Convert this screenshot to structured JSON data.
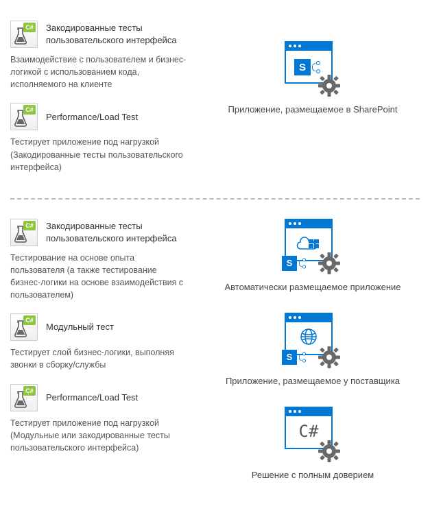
{
  "icons": {
    "test_badge": "C#"
  },
  "section1": {
    "tests": [
      {
        "title": "Закодированные тесты\nпользовательского интерфейса",
        "desc": "Взаимодействие с пользователем и бизнес-логикой с использованием кода, исполняемого на клиенте"
      },
      {
        "title": "Performance/Load Test",
        "desc": "Тестирует приложение под нагрузкой (Закодированные тесты пользовательского интерфейса)"
      }
    ],
    "app": {
      "label": "Приложение, размещаемое в SharePoint"
    }
  },
  "section2": {
    "tests": [
      {
        "title": "Закодированные тесты\nпользовательского интерфейса",
        "desc": "Тестирование на основе опыта пользователя (а также тестирование бизнес-логики на основе взаимодействия с пользователем)"
      },
      {
        "title": "Модульный тест",
        "desc": "Тестирует слой бизнес-логики, выполняя звонки в сборку/службы"
      },
      {
        "title": "Performance/Load Test",
        "desc": "Тестирует приложение под нагрузкой (Модульные или закодированные тесты пользовательского интерфейса)"
      }
    ],
    "apps": [
      {
        "label": "Автоматически размещаемое приложение"
      },
      {
        "label": "Приложение, размещаемое у поставщика"
      },
      {
        "label": "Решение с полным доверием",
        "csharp": "C#"
      }
    ]
  }
}
